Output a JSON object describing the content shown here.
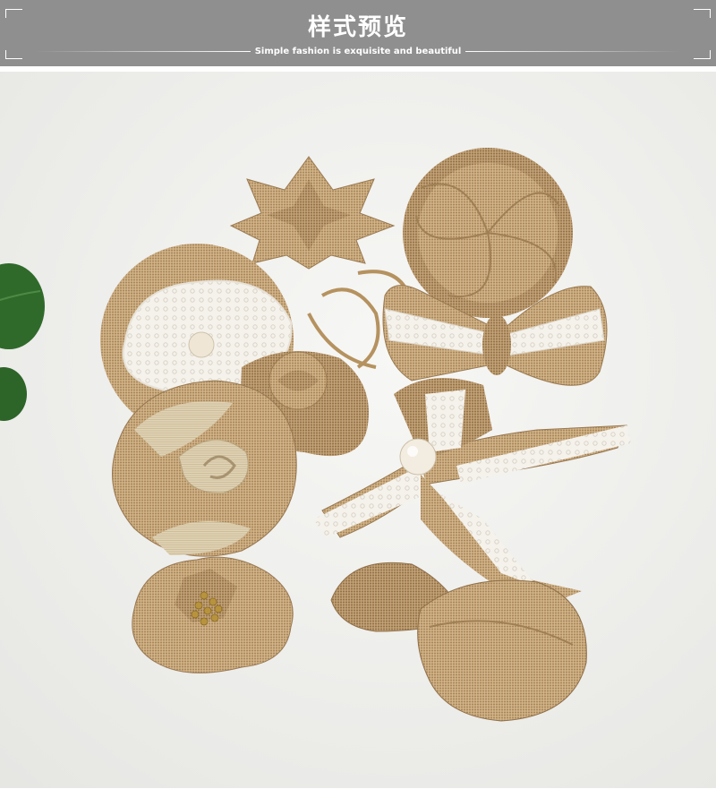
{
  "header": {
    "title": "样式预览",
    "subtitle": "Simple fashion is exquisite and beautiful"
  },
  "photo": {
    "icon": "burlap-flowers-photo"
  },
  "colors": {
    "header_bg": "#8f8f8f",
    "burlap": "#c4a57a",
    "lace": "#f4f1ea",
    "leaf": "#2f6a2a"
  }
}
